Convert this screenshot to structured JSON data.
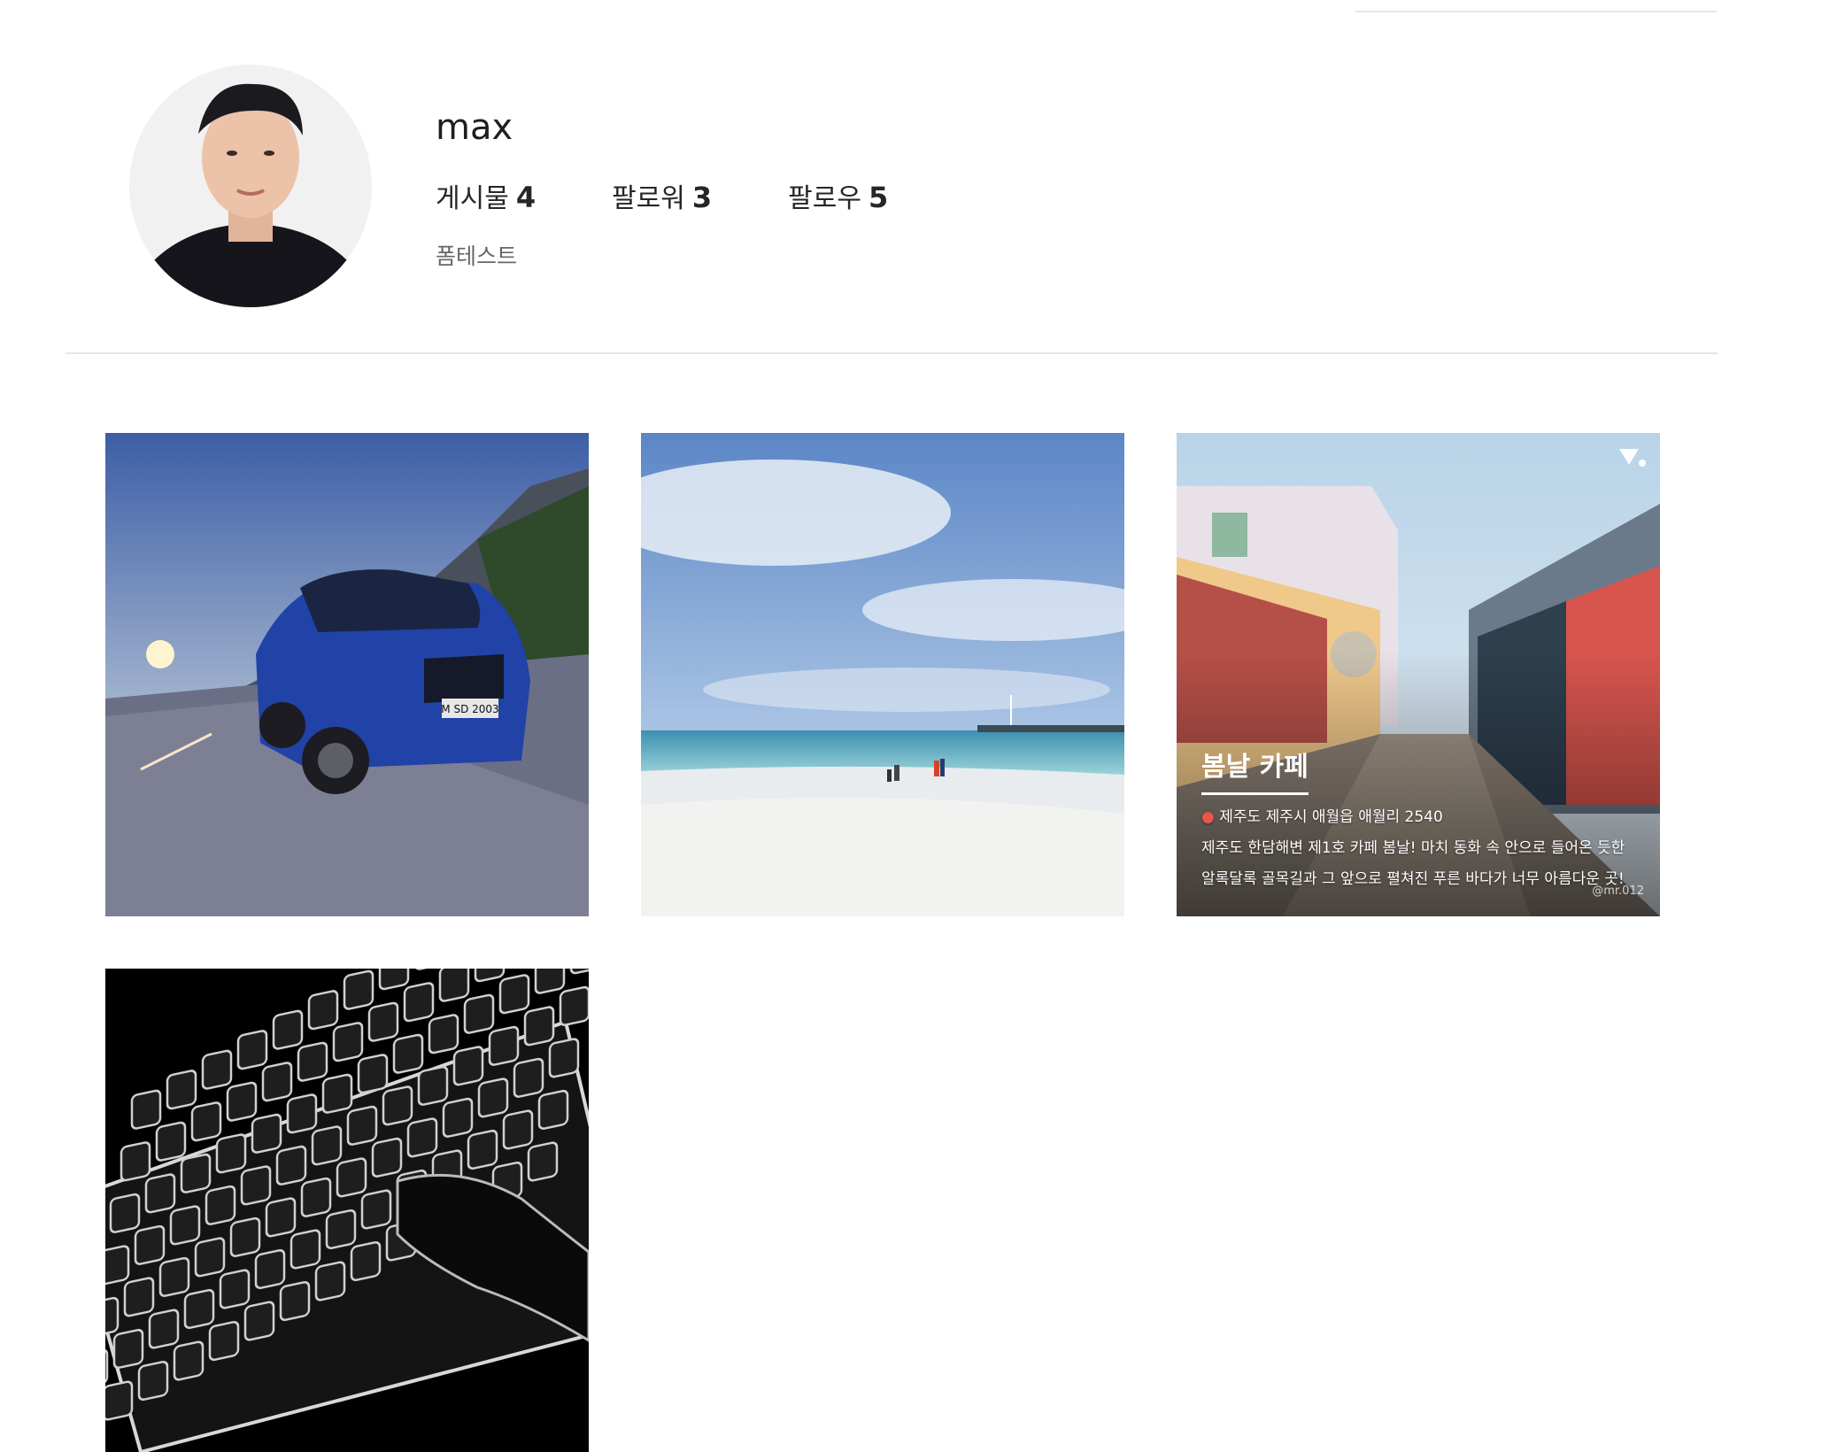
{
  "profile": {
    "username": "max",
    "stats": [
      {
        "label": "게시물",
        "value": "4"
      },
      {
        "label": "팔로워",
        "value": "3"
      },
      {
        "label": "팔로우",
        "value": "5"
      }
    ],
    "bio": "폼테스트"
  },
  "posts": [
    {
      "image": "blue-suv-on-road",
      "plate": "M SD 2003"
    },
    {
      "image": "beach-seascape"
    },
    {
      "image": "cafe-alley",
      "overlay": {
        "title": "봄날 카페",
        "address": "제주도 제주시 애월읍 애월리 2540",
        "line1": "제주도 한담해변 제1호 카페 봄날! 마치 동화 속 안으로 들어온 듯한",
        "line2": "알록달록 골목길과 그 앞으로 펼쳐진 푸른 바다가 너무 아름다운 곳!",
        "credit": "@mr.012"
      }
    },
    {
      "image": "glowing-keyboard"
    }
  ]
}
